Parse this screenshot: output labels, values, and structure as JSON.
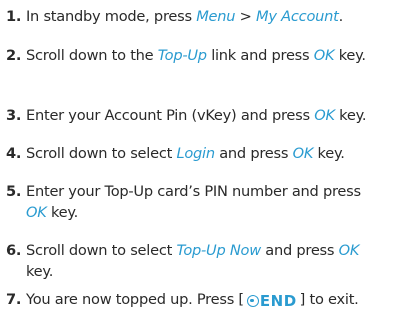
{
  "steps": [
    {
      "number": "1.",
      "parts": [
        {
          "t": "In standby mode, press "
        },
        {
          "t": "Menu",
          "hl": true
        },
        {
          "t": " > "
        },
        {
          "t": "My Account",
          "hl": true
        },
        {
          "t": "."
        }
      ]
    },
    {
      "number": "2.",
      "parts": [
        {
          "t": "Scroll down to the "
        },
        {
          "t": "Top-Up",
          "hl": true
        },
        {
          "t": " link and press "
        },
        {
          "t": "OK",
          "hl": true
        },
        {
          "t": " key."
        }
      ]
    },
    {
      "number": "3.",
      "parts": [
        {
          "t": "Enter your Account Pin (vKey) and press "
        },
        {
          "t": "OK",
          "hl": true
        },
        {
          "t": " key."
        }
      ]
    },
    {
      "number": "4.",
      "parts": [
        {
          "t": "Scroll down to select "
        },
        {
          "t": "Login",
          "hl": true
        },
        {
          "t": " and press "
        },
        {
          "t": "OK",
          "hl": true
        },
        {
          "t": " key."
        }
      ]
    },
    {
      "number": "5.",
      "parts": [
        {
          "t": "Enter your Top-Up card’s PIN number and press "
        },
        {
          "t": "OK",
          "hl": true
        },
        {
          "t": " key."
        }
      ]
    },
    {
      "number": "6.",
      "parts": [
        {
          "t": "Scroll down to select "
        },
        {
          "t": "Top-Up Now",
          "hl": true
        },
        {
          "t": " and press "
        },
        {
          "t": "OK",
          "hl": true
        },
        {
          "t": " key."
        }
      ]
    },
    {
      "number": "7.",
      "parts": [
        {
          "t": "You are now topped up. Press ["
        },
        {
          "icon": "end-key-icon",
          "label": "END"
        },
        {
          "t": "] to exit."
        }
      ]
    }
  ],
  "colors": {
    "text": "#2a2a2a",
    "highlight": "#2a9bd0"
  }
}
